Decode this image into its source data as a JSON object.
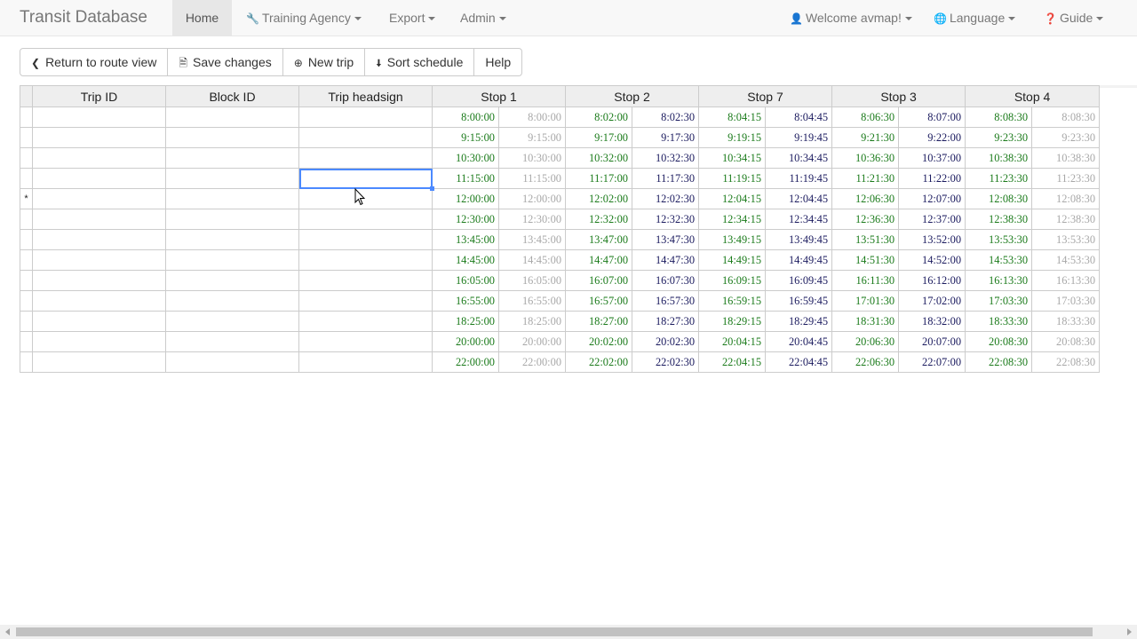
{
  "nav": {
    "brand": "Transit Database",
    "home": "Home",
    "agency": "Training Agency",
    "export": "Export",
    "admin": "Admin",
    "welcome": "Welcome avmap!",
    "language": "Language",
    "guide": "Guide"
  },
  "toolbar": {
    "return": "Return to route view",
    "save": "Save changes",
    "new_trip": "New trip",
    "sort": "Sort schedule",
    "help": "Help"
  },
  "table": {
    "headers": [
      "Trip ID",
      "Block ID",
      "Trip headsign",
      "Stop 1",
      "Stop 2",
      "Stop 7",
      "Stop 3",
      "Stop 4"
    ],
    "rows": [
      {
        "marker": "",
        "times": [
          "8:00:00",
          "8:00:00",
          "8:02:00",
          "8:02:30",
          "8:04:15",
          "8:04:45",
          "8:06:30",
          "8:07:00",
          "8:08:30",
          "8:08:30"
        ]
      },
      {
        "marker": "",
        "times": [
          "9:15:00",
          "9:15:00",
          "9:17:00",
          "9:17:30",
          "9:19:15",
          "9:19:45",
          "9:21:30",
          "9:22:00",
          "9:23:30",
          "9:23:30"
        ]
      },
      {
        "marker": "",
        "times": [
          "10:30:00",
          "10:30:00",
          "10:32:00",
          "10:32:30",
          "10:34:15",
          "10:34:45",
          "10:36:30",
          "10:37:00",
          "10:38:30",
          "10:38:30"
        ]
      },
      {
        "marker": "",
        "times": [
          "11:15:00",
          "11:15:00",
          "11:17:00",
          "11:17:30",
          "11:19:15",
          "11:19:45",
          "11:21:30",
          "11:22:00",
          "11:23:30",
          "11:23:30"
        ]
      },
      {
        "marker": "*",
        "times": [
          "12:00:00",
          "12:00:00",
          "12:02:00",
          "12:02:30",
          "12:04:15",
          "12:04:45",
          "12:06:30",
          "12:07:00",
          "12:08:30",
          "12:08:30"
        ]
      },
      {
        "marker": "",
        "times": [
          "12:30:00",
          "12:30:00",
          "12:32:00",
          "12:32:30",
          "12:34:15",
          "12:34:45",
          "12:36:30",
          "12:37:00",
          "12:38:30",
          "12:38:30"
        ]
      },
      {
        "marker": "",
        "times": [
          "13:45:00",
          "13:45:00",
          "13:47:00",
          "13:47:30",
          "13:49:15",
          "13:49:45",
          "13:51:30",
          "13:52:00",
          "13:53:30",
          "13:53:30"
        ]
      },
      {
        "marker": "",
        "times": [
          "14:45:00",
          "14:45:00",
          "14:47:00",
          "14:47:30",
          "14:49:15",
          "14:49:45",
          "14:51:30",
          "14:52:00",
          "14:53:30",
          "14:53:30"
        ]
      },
      {
        "marker": "",
        "times": [
          "16:05:00",
          "16:05:00",
          "16:07:00",
          "16:07:30",
          "16:09:15",
          "16:09:45",
          "16:11:30",
          "16:12:00",
          "16:13:30",
          "16:13:30"
        ]
      },
      {
        "marker": "",
        "times": [
          "16:55:00",
          "16:55:00",
          "16:57:00",
          "16:57:30",
          "16:59:15",
          "16:59:45",
          "17:01:30",
          "17:02:00",
          "17:03:30",
          "17:03:30"
        ]
      },
      {
        "marker": "",
        "times": [
          "18:25:00",
          "18:25:00",
          "18:27:00",
          "18:27:30",
          "18:29:15",
          "18:29:45",
          "18:31:30",
          "18:32:00",
          "18:33:30",
          "18:33:30"
        ]
      },
      {
        "marker": "",
        "times": [
          "20:00:00",
          "20:00:00",
          "20:02:00",
          "20:02:30",
          "20:04:15",
          "20:04:45",
          "20:06:30",
          "20:07:00",
          "20:08:30",
          "20:08:30"
        ]
      },
      {
        "marker": "",
        "times": [
          "22:00:00",
          "22:00:00",
          "22:02:00",
          "22:02:30",
          "22:04:15",
          "22:04:45",
          "22:06:30",
          "22:07:00",
          "22:08:30",
          "22:08:30"
        ]
      }
    ],
    "selected_row": 3,
    "selected_col": "Trip headsign"
  },
  "colors": {
    "arrival": "#1a7a1a",
    "departure_first": "#a8a8a8",
    "departure": "#1a1a5e",
    "selection": "#4b89ff"
  }
}
